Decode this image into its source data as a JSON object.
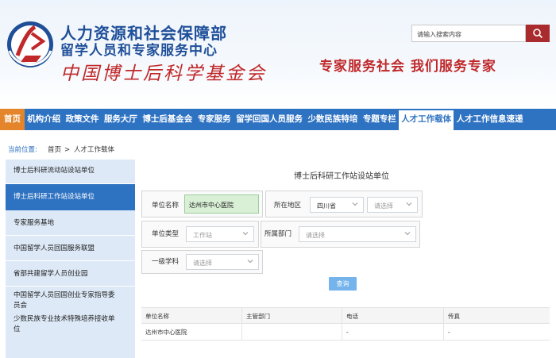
{
  "header": {
    "title_line1": "人力资源和社会保障部",
    "title_line2": "留学人员和专家服务中心",
    "title_line3": "中国博士后科学基金会",
    "search_placeholder": "请输入搜索内容",
    "slogan": "专家服务社会  我们服务专家"
  },
  "nav": {
    "items": [
      {
        "label": "首页",
        "state": "home"
      },
      {
        "label": "机构介绍"
      },
      {
        "label": "政策文件"
      },
      {
        "label": "服务大厅"
      },
      {
        "label": "博士后基金会"
      },
      {
        "label": "专家服务"
      },
      {
        "label": "留学回国人员服务"
      },
      {
        "label": "少数民族特培"
      },
      {
        "label": "专题专栏"
      },
      {
        "label": "人才工作载体",
        "state": "active"
      },
      {
        "label": "人才工作信息速递"
      }
    ]
  },
  "breadcrumb": {
    "label": "当前位置:",
    "home": "首页",
    "sep": ">",
    "current": "人才工作载体"
  },
  "sidebar": {
    "items": [
      {
        "label": "博士后科研流动站设站单位"
      },
      {
        "label": "博士后科研工作站设站单位",
        "active": true
      },
      {
        "label": "专家服务基地"
      },
      {
        "label": "中国留学人员回国服务联盟"
      },
      {
        "label": "省部共建留学人员创业园"
      },
      {
        "label": "中国留学人员回国创业专家指导委员会"
      },
      {
        "label": "少数民族专业技术特殊培养接收单位"
      }
    ]
  },
  "main": {
    "title": "博士后科研工作站设站单位",
    "form": {
      "unit_name_label": "单位名称",
      "unit_name_value": "达州市中心医院",
      "region_label": "所在地区",
      "province_value": "四川省",
      "city_placeholder": "请选择",
      "unit_type_label": "单位类型",
      "unit_type_placeholder": "工作站",
      "dept_label": "所属部门",
      "dept_placeholder": "请选择",
      "discipline_label": "一级学科",
      "discipline_placeholder": "请选择",
      "query_button": "查询"
    },
    "table": {
      "columns": [
        "单位名称",
        "主管部门",
        "电话",
        "传真"
      ],
      "rows": [
        [
          "达州市中心医院",
          "",
          "-",
          "-"
        ]
      ]
    }
  },
  "colors": {
    "nav_blue": "#2e72c2",
    "home_orange": "#e4852b",
    "brand_red": "#c0282a",
    "title_blue": "#1f4f99"
  },
  "icons": {
    "search": "search-icon",
    "chevron": "chevron-down-icon",
    "logo": "logo-icon"
  }
}
